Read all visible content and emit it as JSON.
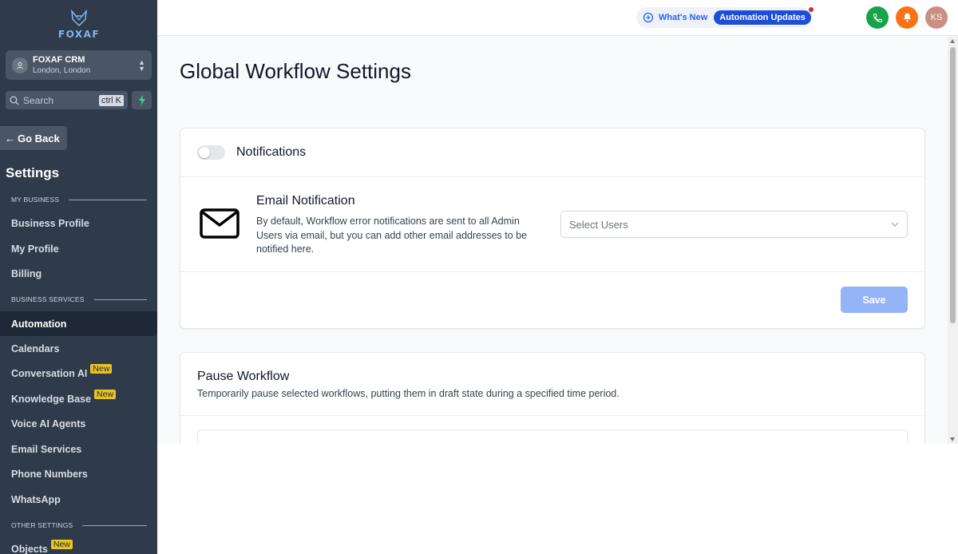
{
  "sidebar": {
    "logo_text": "FOXAF",
    "account": {
      "name": "FOXAF CRM",
      "location": "London, London"
    },
    "search": {
      "placeholder": "Search",
      "shortcut": "ctrl K"
    },
    "go_back": "Go Back",
    "title": "Settings",
    "sections": [
      {
        "label": "MY BUSINESS"
      },
      {
        "label": "BUSINESS SERVICES"
      },
      {
        "label": "OTHER SETTINGS"
      }
    ],
    "items": [
      {
        "label": "Business Profile"
      },
      {
        "label": "My Profile"
      },
      {
        "label": "Billing"
      },
      {
        "label": "Automation",
        "active": true
      },
      {
        "label": "Calendars"
      },
      {
        "label": "Conversation AI",
        "badge": "New"
      },
      {
        "label": "Knowledge Base",
        "badge": "New"
      },
      {
        "label": "Voice AI Agents"
      },
      {
        "label": "Email Services"
      },
      {
        "label": "Phone Numbers"
      },
      {
        "label": "WhatsApp"
      },
      {
        "label": "Objects",
        "badge": "New"
      }
    ]
  },
  "topbar": {
    "whats_new": "What's New",
    "updates_pill": "Automation Updates",
    "avatar_initials": "KS"
  },
  "main": {
    "page_title": "Global Workflow Settings",
    "notifications": {
      "title": "Notifications",
      "toggle_on": false,
      "email_title": "Email Notification",
      "email_desc": "By default, Workflow error notifications are sent to all Admin Users via email, but you can add other email addresses to be notified here.",
      "select_placeholder": "Select Users",
      "save_label": "Save"
    },
    "pause": {
      "title": "Pause Workflow",
      "desc": "Temporarily pause selected workflows, putting them in draft state during a specified time period."
    }
  },
  "colors": {
    "sidebar_bg": "#2f3a4b",
    "accent_blue": "#1d4ed8",
    "save_disabled": "#93b4f6",
    "badge_yellow": "#e8c420",
    "phone_green": "#16a34a",
    "bell_orange": "#f97316"
  }
}
